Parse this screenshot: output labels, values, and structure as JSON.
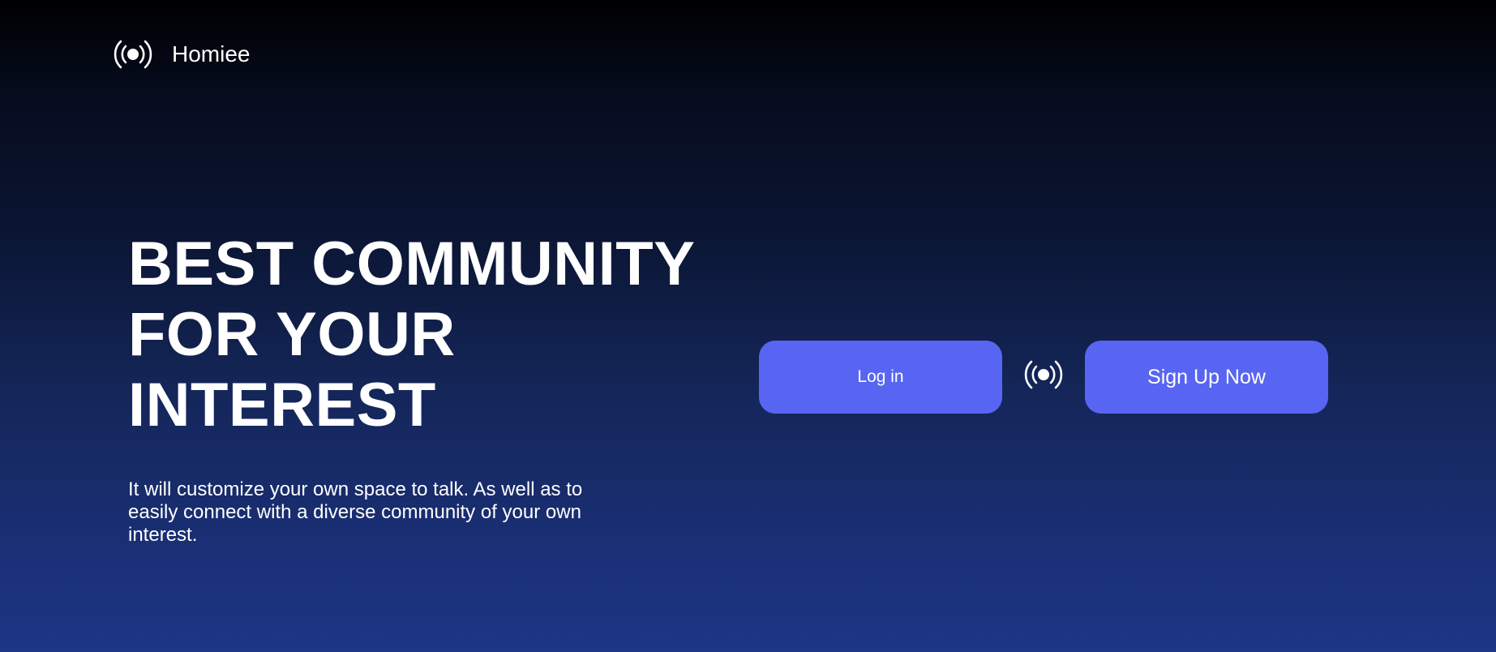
{
  "header": {
    "logo_icon": "broadcast-icon",
    "brand_name": "Homiee"
  },
  "hero": {
    "title_lines": [
      "BEST COMMUNITY",
      "FOR YOUR",
      "INTEREST"
    ],
    "description": "It will customize your own space to talk. As well as to easily connect with a diverse community of your own interest."
  },
  "actions": {
    "login_label": "Log in",
    "divider_icon": "broadcast-icon",
    "signup_label": "Sign Up Now"
  },
  "colors": {
    "button_bg": "#5865f2",
    "text": "#ffffff",
    "bg_top": "#000000",
    "bg_bottom": "#1d3685"
  }
}
